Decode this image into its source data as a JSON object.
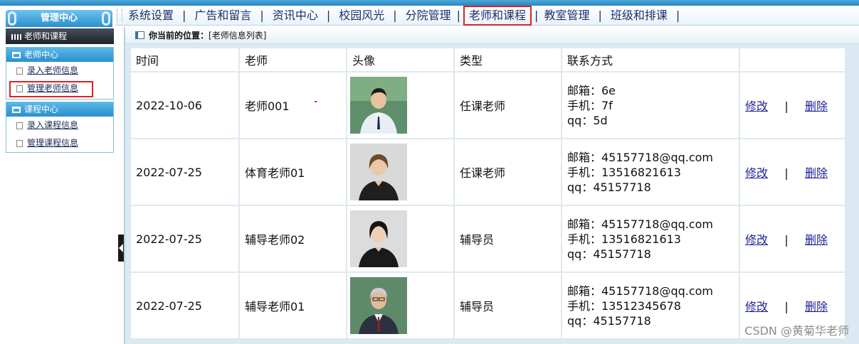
{
  "topnav": {
    "items": [
      "系统设置",
      "广告和留言",
      "资讯中心",
      "校园风光",
      "分院管理",
      "老师和课程",
      "教室管理",
      "班级和排课"
    ],
    "separator": "|"
  },
  "sidebar": {
    "header": "管理中心",
    "category": "老师和课程",
    "groups": [
      {
        "title": "老师中心",
        "items": [
          "录入老师信息",
          "管理老师信息"
        ]
      },
      {
        "title": "课程中心",
        "items": [
          "录入课程信息",
          "管理课程信息"
        ]
      }
    ]
  },
  "breadcrumb": {
    "label": "你当前的位置：",
    "path": "[老师信息列表]"
  },
  "table": {
    "headers": [
      "时间",
      "老师",
      "头像",
      "类型",
      "联系方式",
      ""
    ],
    "rows": [
      {
        "time": "2022-10-06",
        "teacher": "老师001",
        "type": "任课老师",
        "email": "邮箱：6e",
        "phone": "手机：7f",
        "qq": "qq：5d",
        "edit": "修改",
        "sep": "|",
        "del": "删除"
      },
      {
        "time": "2022-07-25",
        "teacher": "体育老师01",
        "type": "任课老师",
        "email": "邮箱：45157718@qq.com",
        "phone": "手机：13516821613",
        "qq": "qq：45157718",
        "edit": "修改",
        "sep": "|",
        "del": "删除"
      },
      {
        "time": "2022-07-25",
        "teacher": "辅导老师02",
        "type": "辅导员",
        "email": "邮箱：45157718@qq.com",
        "phone": "手机：13516821613",
        "qq": "qq：45157718",
        "edit": "修改",
        "sep": "|",
        "del": "删除"
      },
      {
        "time": "2022-07-25",
        "teacher": "辅导老师01",
        "type": "辅导员",
        "email": "邮箱：45157718@qq.com",
        "phone": "手机：13512345678",
        "qq": "qq：45157718",
        "edit": "修改",
        "sep": "|",
        "del": "删除"
      }
    ]
  },
  "watermark": "CSDN @黄菊华老师",
  "colors": {
    "accent": "#2a8fcf",
    "highlight": "#e02020",
    "link": "#1f1f99"
  }
}
